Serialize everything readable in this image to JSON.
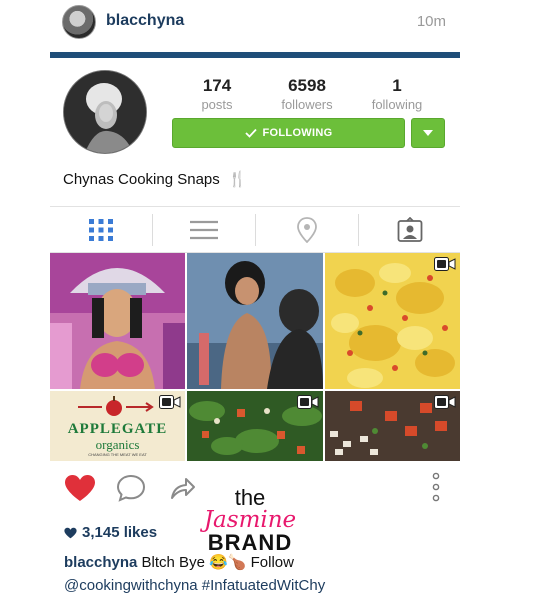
{
  "header": {
    "username": "blacchyna",
    "time": "10m"
  },
  "profile": {
    "stats": [
      {
        "value": "174",
        "label": "posts"
      },
      {
        "value": "6598",
        "label": "followers"
      },
      {
        "value": "1",
        "label": "following"
      }
    ],
    "following_button": "FOLLOWING",
    "bio": "Chynas Cooking Snaps",
    "bio_icon": "fork-knife-icon"
  },
  "tabs": [
    "grid-icon",
    "list-icon",
    "location-pin-icon",
    "tagged-person-icon"
  ],
  "grid": {
    "tiles": [
      {
        "name": "carnival-photo",
        "video": false
      },
      {
        "name": "portrait-photo",
        "video": false
      },
      {
        "name": "scrambled-eggs-photo",
        "video": true
      },
      {
        "name": "applegate-organics-photo",
        "video": true,
        "brand_text": "APPLEGATE",
        "brand_sub": "organics",
        "brand_tagline": "CHANGING THE MEAT WE EAT"
      },
      {
        "name": "greens-photo",
        "video": true
      },
      {
        "name": "chopped-vegetables-photo",
        "video": true
      }
    ]
  },
  "post": {
    "likes": "3,145 likes",
    "caption_user": "blacchyna",
    "caption_text": "Bltch Bye",
    "caption_follow": "Follow",
    "caption_line2": "@cookingwithchyna #InfatuatedWitChy"
  },
  "watermark": {
    "the": "the",
    "jasmine": "Jasmine",
    "brand": "BRAND"
  },
  "colors": {
    "accent_green": "#6cbf3a",
    "header_bar": "#1f4e79",
    "username_blue": "#1d3c5e",
    "heart_red": "#e0303a",
    "watermark_pink": "#e8186d"
  }
}
